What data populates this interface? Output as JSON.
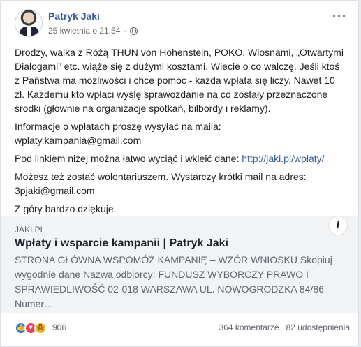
{
  "post": {
    "author": "Patryk Jaki",
    "timestamp": "25 kwietnia o 21:54",
    "separator": "·",
    "more_label": "···",
    "paragraphs": [
      "Drodzy, walka z Różą THUN von Hohenstein, POKO, Wiosnami, „Otwartymi Dialogami” etc. wiąże się z dużymi kosztami. Wiecie o co walczę. Jeśli ktoś z Państwa ma możliwości i chce pomoc - każda wpłata się liczy. Nawet 10 zł. Każdemu kto wpłaci wyślę sprawozdanie na co zostały przeznaczone środki (głównie na organizacje spotkań, bilbordy i reklamy).",
      "Informacje o wpłatach proszę wysyłać na maila: wplaty.kampania@gmail.com",
      "Pod linkiem niżej można łatwo wyciąć i wkleić dane: ",
      "Możesz też zostać wolontariuszem. Wystarczy krótki mail na adres: 3pjaki@gmail.com",
      "Z góry bardzo dziękuje."
    ],
    "link": "http://jaki.pl/wplaty/"
  },
  "preview": {
    "domain": "JAKI.PL",
    "title": "Wpłaty i wsparcie kampanii | Patryk Jaki",
    "description": "STRONA GŁÓWNA WSPOMÓŻ KAMPANIĘ – WZÓR WNIOSKU Skopiuj wygodnie dane Nazwa odbiorcy: FUNDUSZ WYBORCZY PRAWO I SPRAWIEDLIWOŚĆ 02-018 WARSZAWA UL. NOWOGRODZKA 84/86 Numer…",
    "info_label": "i"
  },
  "footer": {
    "reaction_count": "906",
    "comments": "364 komentarze",
    "shares": "82 udostępnienia"
  },
  "icons": {
    "like": "thumbs-up",
    "love": "heart",
    "haha": "laughing-face"
  },
  "colors": {
    "link": "#385898",
    "like": "#2078f4",
    "love": "#f33e58",
    "haha": "#f7b125"
  }
}
